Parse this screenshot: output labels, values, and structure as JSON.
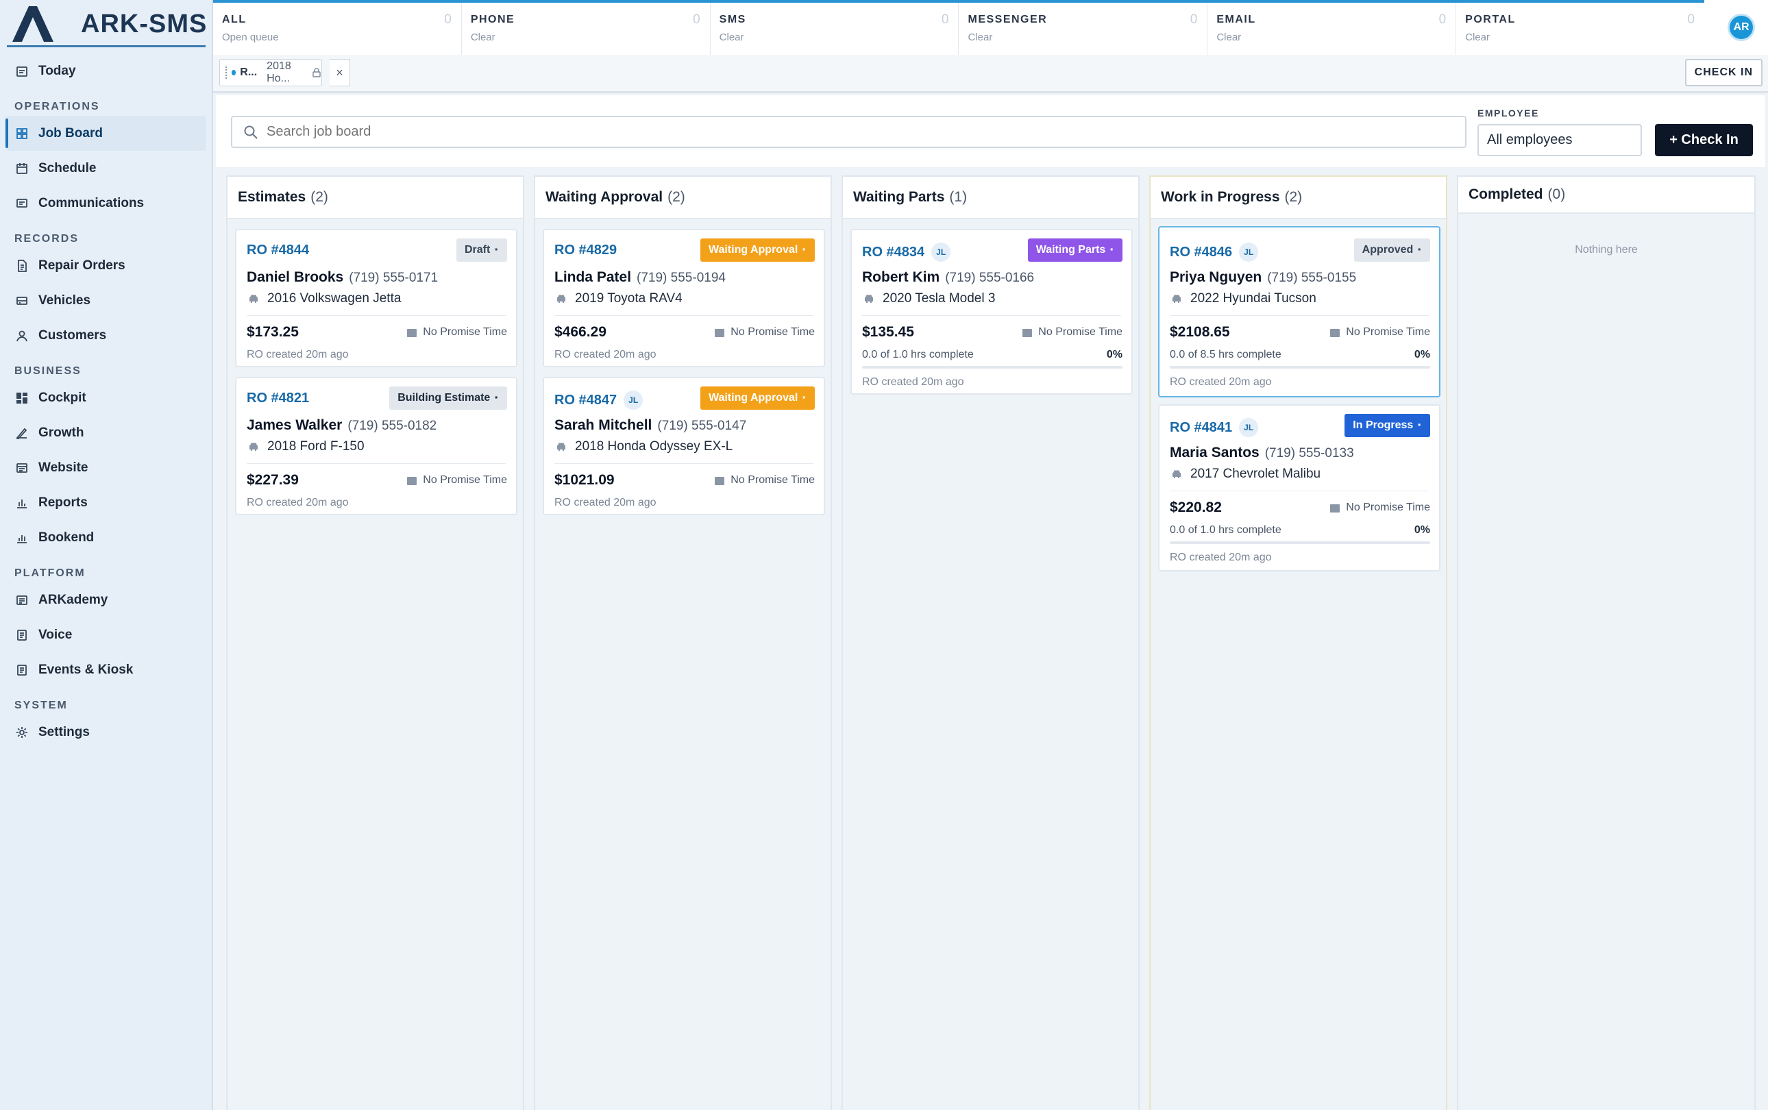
{
  "brand": {
    "name": "ARK-SMS"
  },
  "nav": {
    "today": "Today",
    "sections": {
      "operations": "OPERATIONS",
      "records": "RECORDS",
      "business": "BUSINESS",
      "platform": "PLATFORM",
      "system": "SYSTEM"
    },
    "items": {
      "job_board": "Job Board",
      "schedule": "Schedule",
      "communications": "Communications",
      "repair_orders": "Repair Orders",
      "vehicles": "Vehicles",
      "customers": "Customers",
      "cockpit": "Cockpit",
      "growth": "Growth",
      "website": "Website",
      "reports": "Reports",
      "bookend": "Bookend",
      "arkademy": "ARKademy",
      "voice": "Voice",
      "events_kiosk": "Events & Kiosk",
      "settings": "Settings"
    }
  },
  "channels": [
    {
      "name": "ALL",
      "sub": "Open queue",
      "count": "0"
    },
    {
      "name": "PHONE",
      "sub": "Clear",
      "count": "0"
    },
    {
      "name": "SMS",
      "sub": "Clear",
      "count": "0"
    },
    {
      "name": "MESSENGER",
      "sub": "Clear",
      "count": "0"
    },
    {
      "name": "EMAIL",
      "sub": "Clear",
      "count": "0"
    },
    {
      "name": "PORTAL",
      "sub": "Clear",
      "count": "0"
    }
  ],
  "user": {
    "initials": "AR"
  },
  "tabstrip": {
    "tab_label": "R...",
    "tab_vehicle": "2018 Ho...",
    "close": "×",
    "check_in": "CHECK IN"
  },
  "toolbar": {
    "search_placeholder": "Search job board",
    "employee_label": "EMPLOYEE",
    "employee_value": "All employees",
    "check_in_button": "+ Check In"
  },
  "columns": {
    "estimates": {
      "title": "Estimates",
      "count": "(2)"
    },
    "waiting_approval": {
      "title": "Waiting Approval",
      "count": "(2)"
    },
    "waiting_parts": {
      "title": "Waiting Parts",
      "count": "(1)"
    },
    "work_in_progress": {
      "title": "Work in Progress",
      "count": "(2)"
    },
    "completed": {
      "title": "Completed",
      "count": "(0)",
      "empty": "Nothing here"
    }
  },
  "cards": {
    "c4844": {
      "ro": "RO #4844",
      "status": "Draft",
      "name": "Daniel Brooks",
      "phone": "(719) 555-0171",
      "vehicle": "2016 Volkswagen Jetta",
      "price": "$173.25",
      "promise": "No Promise Time",
      "created": "RO created 20m ago"
    },
    "c4821": {
      "ro": "RO #4821",
      "status": "Building Estimate",
      "name": "James Walker",
      "phone": "(719) 555-0182",
      "vehicle": "2018 Ford F-150",
      "price": "$227.39",
      "promise": "No Promise Time",
      "created": "RO created 20m ago"
    },
    "c4829": {
      "ro": "RO #4829",
      "status": "Waiting Approval",
      "name": "Linda Patel",
      "phone": "(719) 555-0194",
      "vehicle": "2019 Toyota RAV4",
      "price": "$466.29",
      "promise": "No Promise Time",
      "created": "RO created 20m ago"
    },
    "c4847": {
      "ro": "RO #4847",
      "tech": "JL",
      "status": "Waiting Approval",
      "name": "Sarah Mitchell",
      "phone": "(719) 555-0147",
      "vehicle": "2018 Honda Odyssey EX-L",
      "price": "$1021.09",
      "promise": "No Promise Time",
      "created": "RO created 20m ago"
    },
    "c4834": {
      "ro": "RO #4834",
      "tech": "JL",
      "status": "Waiting Parts",
      "name": "Robert Kim",
      "phone": "(719) 555-0166",
      "vehicle": "2020 Tesla Model 3",
      "price": "$135.45",
      "promise": "No Promise Time",
      "hours": "0.0 of 1.0 hrs complete",
      "pct": "0%",
      "progress": 0,
      "created": "RO created 20m ago"
    },
    "c4846": {
      "ro": "RO #4846",
      "tech": "JL",
      "status": "Approved",
      "name": "Priya Nguyen",
      "phone": "(719) 555-0155",
      "vehicle": "2022 Hyundai Tucson",
      "price": "$2108.65",
      "promise": "No Promise Time",
      "hours": "0.0 of 8.5 hrs complete",
      "pct": "0%",
      "progress": 0,
      "created": "RO created 20m ago"
    },
    "c4841": {
      "ro": "RO #4841",
      "tech": "JL",
      "status": "In Progress",
      "name": "Maria Santos",
      "phone": "(719) 555-0133",
      "vehicle": "2017 Chevrolet Malibu",
      "price": "$220.82",
      "promise": "No Promise Time",
      "hours": "0.0 of 1.0 hrs complete",
      "pct": "0%",
      "progress": 0,
      "created": "RO created 20m ago"
    }
  },
  "colors": {
    "accent": "#1769a8",
    "waiting": "#f4a11a",
    "parts": "#8f55e8",
    "in_progress": "#1f63d6",
    "primary_button": "#0d1626"
  },
  "icons": {
    "today": "calendar-icon",
    "job_board": "grid-icon",
    "schedule": "calendar-icon",
    "communications": "message-icon",
    "repair_orders": "document-icon",
    "vehicles": "car-icon",
    "customers": "user-icon",
    "cockpit": "dashboard-icon",
    "growth": "pen-icon",
    "website": "browser-icon",
    "reports": "bar-chart-icon",
    "bookend": "bar-chart-icon",
    "arkademy": "book-icon",
    "voice": "phone-icon",
    "events_kiosk": "calendar-icon",
    "settings": "gear-icon",
    "search": "search-icon",
    "vehicle": "car-icon",
    "promise": "calendar-icon",
    "lock": "lock-icon",
    "close": "close-icon"
  }
}
